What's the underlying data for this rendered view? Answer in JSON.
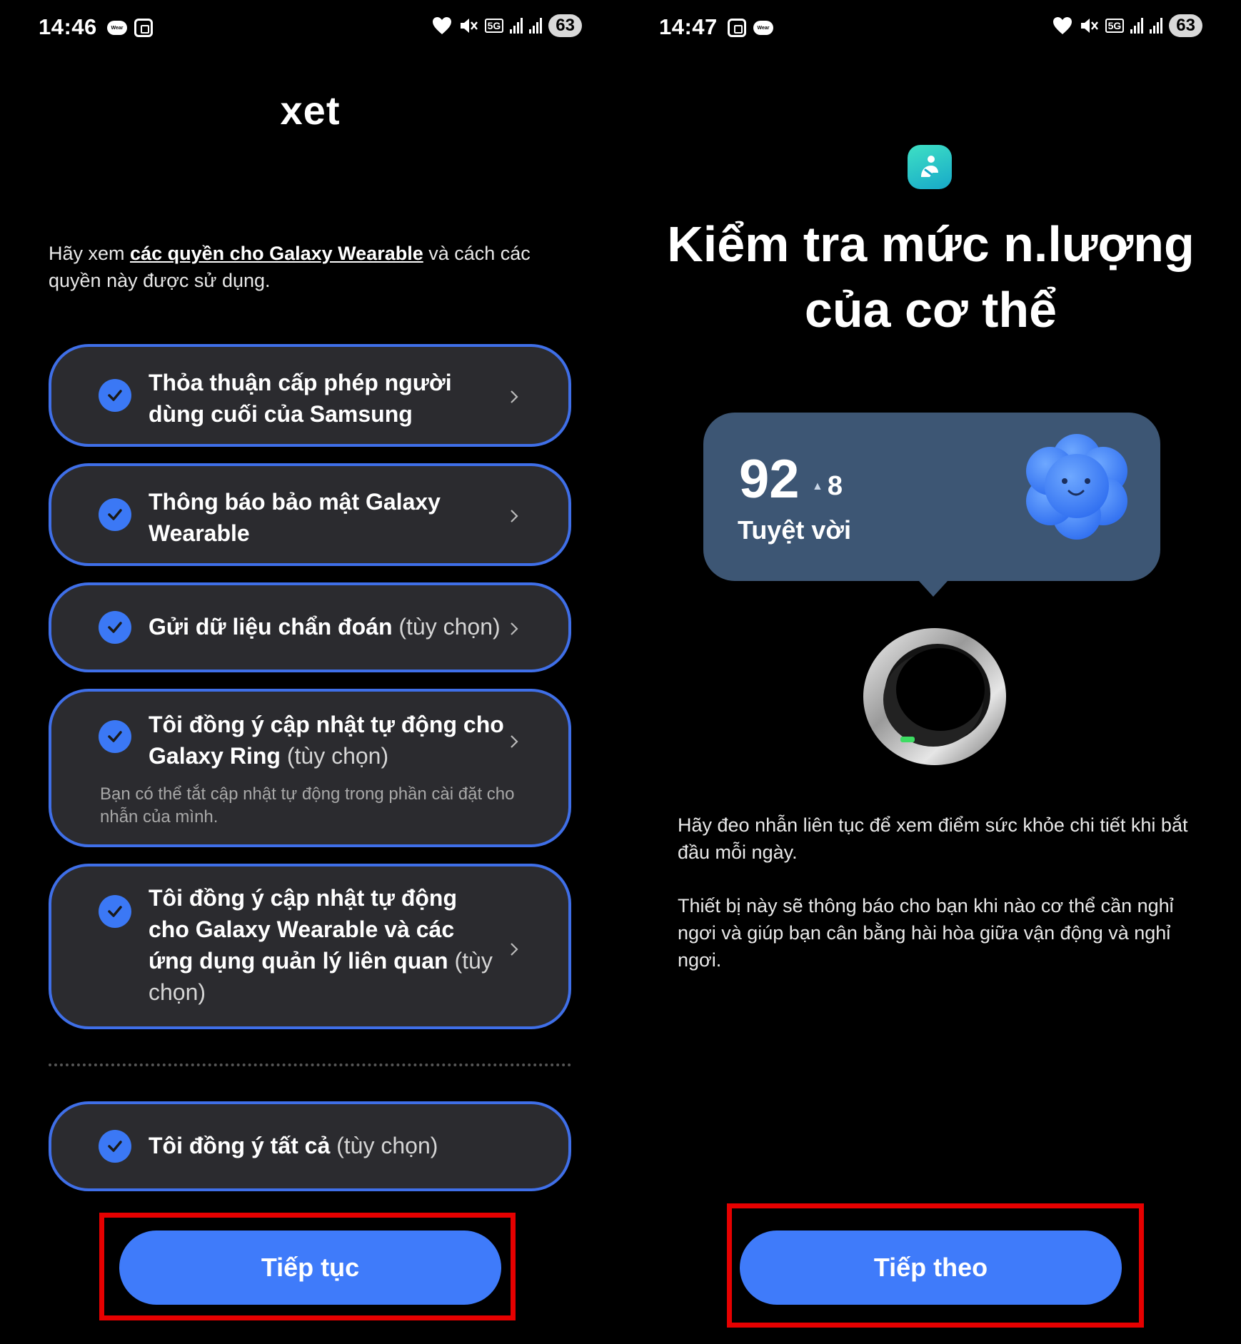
{
  "left_screen": {
    "status_bar": {
      "time": "14:46",
      "battery": "63",
      "network": "5G"
    },
    "logo_text": "xet",
    "intro": {
      "prefix": "Hãy xem ",
      "link": "các quyền cho Galaxy Wearable",
      "suffix": " và cách các quyền này được sử dụng."
    },
    "permissions": [
      {
        "label": "Thỏa thuận cấp phép người dùng cuối của Samsung",
        "optional": "",
        "note": ""
      },
      {
        "label": "Thông báo bảo mật Galaxy Wearable",
        "optional": "",
        "note": ""
      },
      {
        "label": "Gửi dữ liệu chẩn đoán",
        "optional": "(tùy chọn)",
        "note": ""
      },
      {
        "label": "Tôi đồng ý cập nhật tự động cho Galaxy Ring",
        "optional": "(tùy chọn)",
        "note": "Bạn có thể tắt cập nhật tự động trong phần cài đặt cho nhẫn của mình."
      },
      {
        "label": "Tôi đồng ý cập nhật tự động cho Galaxy Wearable và các ứng dụng quản lý liên quan",
        "optional": "(tùy chọn)",
        "note": ""
      }
    ],
    "agree_all": {
      "label": "Tôi đồng ý tất cả",
      "optional": "(tùy chọn)"
    },
    "continue_button": "Tiếp tục"
  },
  "right_screen": {
    "status_bar": {
      "time": "14:47",
      "battery": "63",
      "network": "5G"
    },
    "heading_line1": "Kiểm tra mức n.lượng",
    "heading_line2": "của cơ thể",
    "score": {
      "value": "92",
      "delta": "8",
      "label": "Tuyệt vời"
    },
    "paragraph1": "Hãy đeo nhẫn liên tục để xem điểm sức khỏe chi tiết khi bắt đầu mỗi ngày.",
    "paragraph2": "Thiết bị này sẽ thông báo cho bạn khi nào cơ thể cần nghỉ ngơi và giúp bạn cân bằng hài hòa giữa vận động và nghỉ ngơi.",
    "next_button": "Tiếp theo"
  },
  "colors": {
    "accent": "#3f7bfa",
    "card_bg": "#2b2b2f",
    "card_border": "#3f6fe8",
    "score_card": "#3d5674",
    "highlight": "#e60000"
  },
  "icons": [
    "heart-icon",
    "mute-icon",
    "signal-icon",
    "check-icon",
    "chevron-right-icon",
    "ring-image",
    "cloud-mascot-icon",
    "samsung-health-icon"
  ]
}
